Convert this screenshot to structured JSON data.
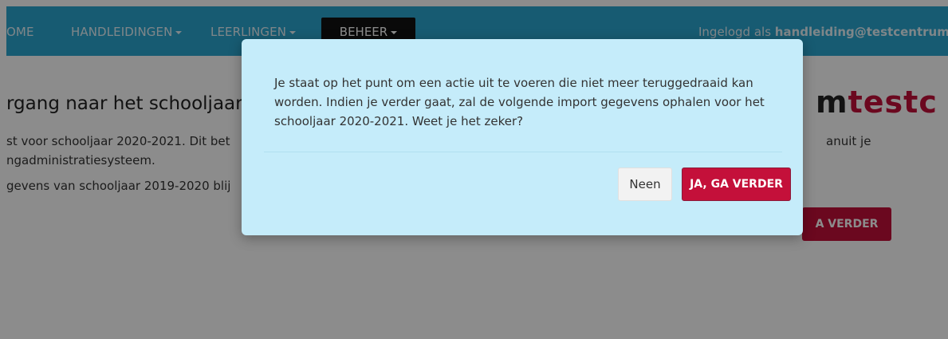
{
  "navbar": {
    "home_label": "OME",
    "handleidingen_label": "HANDLEIDINGEN",
    "leerlingen_label": "LEERLINGEN",
    "beheer_label": "BEHEER",
    "user_prefix": "Ingelogd als",
    "user_email": "handleiding@testcentrum"
  },
  "page": {
    "title": "rgang naar het schooljaar 2",
    "line1": "st voor schooljaar 2020-2021. Dit bet",
    "line1_right": "anuit je",
    "line2": "ngadministratiesysteem.",
    "line3": "gevens van schooljaar 2019-2020 blij",
    "brand_m": "m",
    "brand_testc": "testc",
    "continue_label": "A VERDER"
  },
  "modal": {
    "body_text": "Je staat op het punt om een actie uit te voeren die niet meer teruggedraaid kan worden. Indien je verder gaat, zal de volgende import gegevens ophalen voor het schooljaar 2020-2021. Weet je het zeker?",
    "cancel_label": "Neen",
    "confirm_label": "JA, GA VERDER"
  },
  "colors": {
    "navbar": "#2aa6d0",
    "modal_bg": "#c5ecfa",
    "accent": "#c4103a"
  }
}
